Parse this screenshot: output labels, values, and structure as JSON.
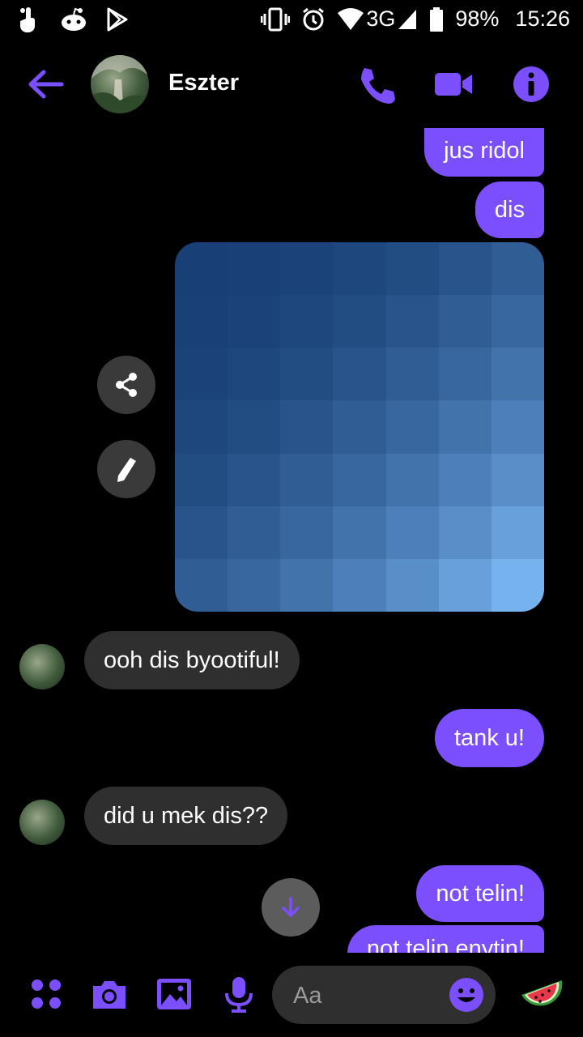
{
  "status_bar": {
    "network": "3G",
    "battery": "98%",
    "time": "15:26"
  },
  "header": {
    "contact_name": "Eszter",
    "accent": "#7b4ffd"
  },
  "messages": [
    {
      "side": "out",
      "text": "jus ridol"
    },
    {
      "side": "out",
      "text": "dis"
    },
    {
      "side": "out",
      "type": "image"
    },
    {
      "side": "in",
      "text": "ooh dis byootiful!"
    },
    {
      "side": "out",
      "text": "tank u!"
    },
    {
      "side": "in",
      "text": "did u mek dis??"
    },
    {
      "side": "out",
      "text": "not telin!"
    },
    {
      "side": "out",
      "text": "not telin enytin!"
    }
  ],
  "composer": {
    "placeholder": "Aa"
  },
  "icons": [
    "back-arrow-icon",
    "phone-icon",
    "video-camera-icon",
    "info-icon",
    "share-icon",
    "pencil-icon",
    "arrow-down-icon",
    "apps-icon",
    "camera-icon",
    "gallery-icon",
    "microphone-icon",
    "emoji-icon",
    "watermelon-icon"
  ]
}
